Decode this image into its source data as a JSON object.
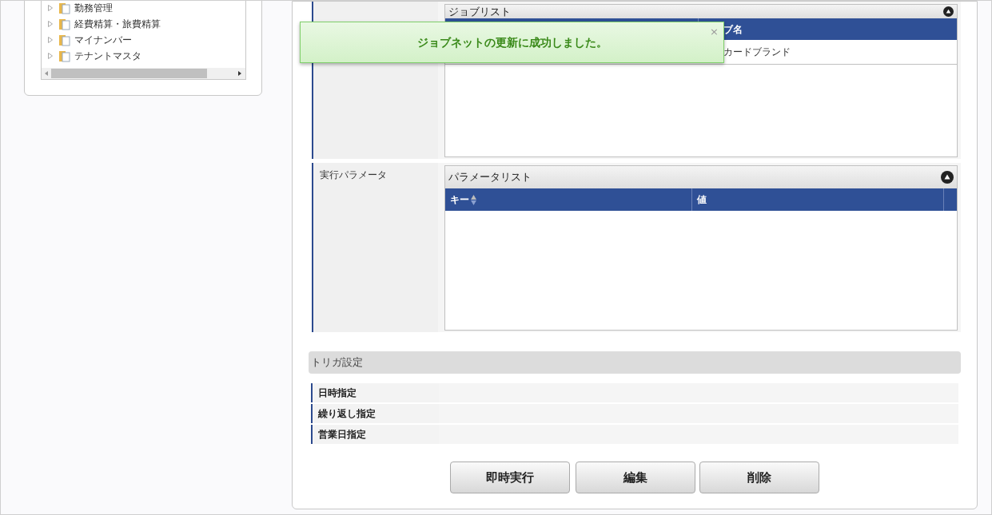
{
  "tree": {
    "items": [
      {
        "label": "勤務管理",
        "expanded": false
      },
      {
        "label": "経費精算・旅費精算",
        "expanded": false
      },
      {
        "label": "マイナンバー",
        "expanded": false
      },
      {
        "label": "テナントマスタ",
        "expanded": false
      }
    ]
  },
  "toast": {
    "message": "ジョブネットの更新に成功しました。",
    "close": "×"
  },
  "job_section": {
    "list_title": "ジョブリスト",
    "columns": [
      "ブ名"
    ],
    "rows": [
      [
        "カードブランド"
      ]
    ]
  },
  "param_section": {
    "label": "実行パラメータ",
    "list_title": "パラメータリスト",
    "columns": [
      {
        "label": "キー",
        "sortable": true
      },
      {
        "label": "値",
        "sortable": false
      }
    ]
  },
  "trigger": {
    "title": "トリガ設定",
    "rows": [
      "日時指定",
      "繰り返し指定",
      "営業日指定"
    ]
  },
  "buttons": [
    "即時実行",
    "編集",
    "削除"
  ]
}
